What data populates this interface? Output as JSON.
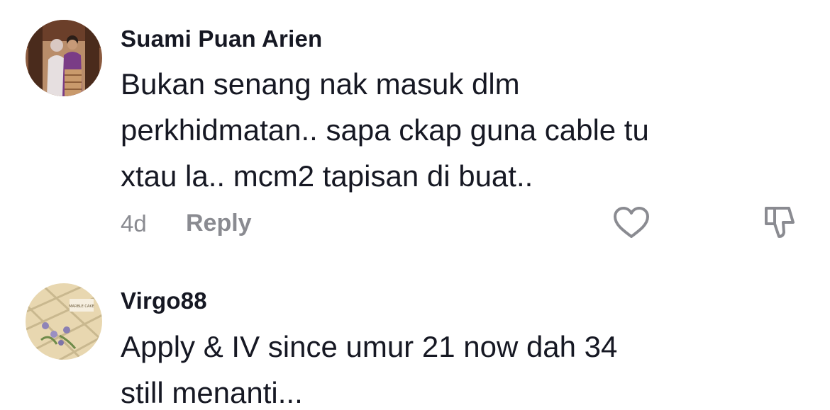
{
  "comments": [
    {
      "username": "Suami Puan Arien",
      "lines": [
        "Bukan senang nak masuk dlm",
        "perkhidmatan.. sapa ckap guna cable tu",
        "xtau la.. mcm2 tapisan di buat.."
      ],
      "time": "4d",
      "reply_label": "Reply",
      "avatar_icon": "couple-photo-avatar",
      "like_icon": "heart-outline-icon",
      "dislike_icon": "thumbs-down-icon"
    },
    {
      "username": "Virgo88",
      "avatar_text": "MARBLE CAKE",
      "lines": [
        "Apply & IV since umur 21 now dah 34",
        "still menanti..."
      ],
      "avatar_icon": "cake-photo-avatar"
    }
  ],
  "colors": {
    "text_primary": "#161823",
    "text_secondary": "#8a8b91",
    "icon": "#8a8b91",
    "background": "#ffffff"
  }
}
